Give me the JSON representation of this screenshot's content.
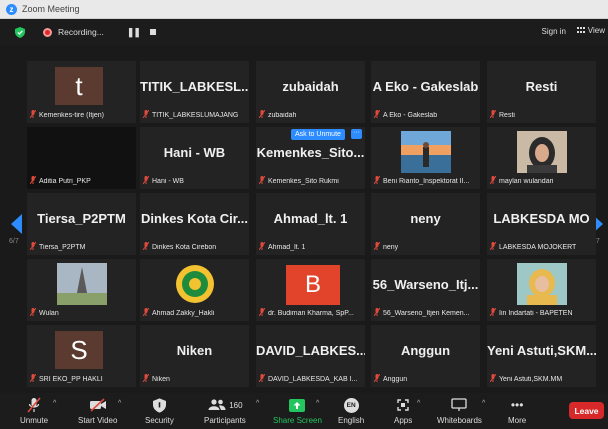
{
  "window": {
    "title": "Zoom Meeting"
  },
  "topbar": {
    "recording_label": "Recording...",
    "signin_label": "Sign in",
    "view_label": "View"
  },
  "tiles": [
    {
      "big": "t",
      "name": "Kemenkes-tire (Itjen)",
      "type": "avatar"
    },
    {
      "big": "TITIK_LABKESL...",
      "name": "TITIK_LABKESLUMAJANG",
      "type": "text"
    },
    {
      "big": "zubaidah",
      "name": "zubaidah",
      "type": "text"
    },
    {
      "big": "A Eko - Gakeslab",
      "name": "A Eko - Gakeslab",
      "type": "text"
    },
    {
      "big": "Resti",
      "name": "Resti",
      "type": "text"
    },
    {
      "big": "",
      "name": "Aditia Putri_PKP",
      "type": "dark"
    },
    {
      "big": "Hani - WB",
      "name": "Hani - WB",
      "type": "text"
    },
    {
      "big": "Kemenkes_Sito...",
      "name": "Kemenkes_Sito Rukmi",
      "type": "text"
    },
    {
      "big": "",
      "name": "Beni Rianto_Inspektorat II...",
      "type": "photo-beach"
    },
    {
      "big": "",
      "name": "maylan wulandari",
      "type": "photo-woman"
    },
    {
      "big": "Tiersa_P2PTM",
      "name": "Tiersa_P2PTM",
      "type": "text"
    },
    {
      "big": "Dinkes Kota Cir...",
      "name": "Dinkes Kota Cirebon",
      "type": "text"
    },
    {
      "big": "Ahmad_lt. 1",
      "name": "Ahmad_lt. 1",
      "type": "text"
    },
    {
      "big": "neny",
      "name": "neny",
      "type": "text"
    },
    {
      "big": "LABKESDA MO",
      "name": "LABKESDA MOJOKERT",
      "type": "text"
    },
    {
      "big": "",
      "name": "Wulan",
      "type": "photo-eiffel"
    },
    {
      "big": "",
      "name": "Ahmad Zakky_Hakli",
      "type": "photo-logo"
    },
    {
      "big": "B",
      "name": "dr. Budiman Kharma, SpP...",
      "type": "square"
    },
    {
      "big": "56_Warseno_Itj...",
      "name": "56_Warseno_Itjen Kemen...",
      "type": "text"
    },
    {
      "big": "",
      "name": "Iin Indartati - BAPETEN",
      "type": "photo-woman2"
    },
    {
      "big": "S",
      "name": "SRI EKO_PP HAKLI",
      "type": "avatar"
    },
    {
      "big": "Niken",
      "name": "Niken",
      "type": "text"
    },
    {
      "big": "DAVID_LABKES...",
      "name": "DAVID_LABKESDA_KAB I...",
      "type": "text"
    },
    {
      "big": "Anggun",
      "name": "Anggun",
      "type": "text"
    },
    {
      "big": "Yeni Astuti,SKM...",
      "name": "Yeni Astuti,SKM.MM",
      "type": "text"
    }
  ],
  "overlay": {
    "ask_to_unmute": "Ask to Unmute",
    "more": "···"
  },
  "pagination": {
    "left": "6/7",
    "right": "6/7"
  },
  "toolbar": {
    "unmute": "Unmute",
    "start_video": "Start Video",
    "security": "Security",
    "participants": "Participants",
    "participants_count": "160",
    "share_screen": "Share Screen",
    "english": "English",
    "apps": "Apps",
    "whiteboards": "Whiteboards",
    "more": "More",
    "leave": "Leave",
    "en_badge": "EN",
    "more_dots": "•••"
  },
  "colors": {
    "accent": "#2d8cff",
    "leave": "#d8292a",
    "share": "#22c55e",
    "muted": "#e04a3b"
  }
}
